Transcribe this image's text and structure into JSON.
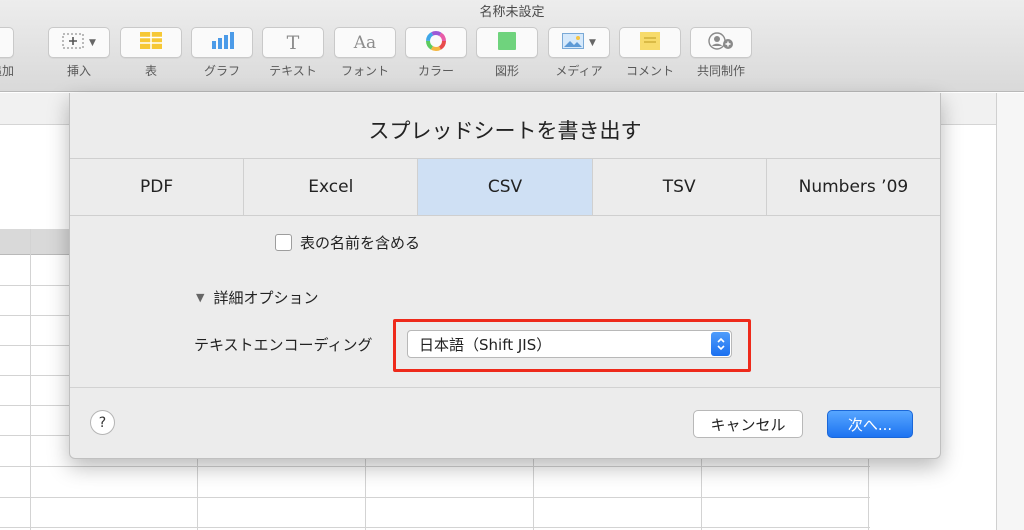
{
  "window": {
    "title": "名称未設定"
  },
  "toolbar": {
    "items": [
      {
        "label": "を追加"
      },
      {
        "label": "挿入"
      },
      {
        "label": "表"
      },
      {
        "label": "グラフ"
      },
      {
        "label": "テキスト",
        "glyph": "T"
      },
      {
        "label": "フォント",
        "glyph": "Aa"
      },
      {
        "label": "カラー"
      },
      {
        "label": "図形"
      },
      {
        "label": "メディア"
      },
      {
        "label": "コメント"
      },
      {
        "label": "共同制作"
      }
    ]
  },
  "dialog": {
    "title": "スプレッドシートを書き出す",
    "tabs": [
      {
        "label": "PDF",
        "selected": false
      },
      {
        "label": "Excel",
        "selected": false
      },
      {
        "label": "CSV",
        "selected": true
      },
      {
        "label": "TSV",
        "selected": false
      },
      {
        "label": "Numbers ’09",
        "selected": false
      }
    ],
    "include_table_names": {
      "label": "表の名前を含める",
      "checked": false
    },
    "advanced": {
      "label": "詳細オプション",
      "expanded": true
    },
    "encoding": {
      "label": "テキストエンコーディング",
      "value": "日本語（Shift JIS）"
    },
    "help_label": "?",
    "cancel_label": "キャンセル",
    "next_label": "次へ..."
  },
  "colors": {
    "selected_tab": "#cfe0f4",
    "primary_button": "#1d73f1",
    "highlight_box": "#ee2a1b"
  }
}
